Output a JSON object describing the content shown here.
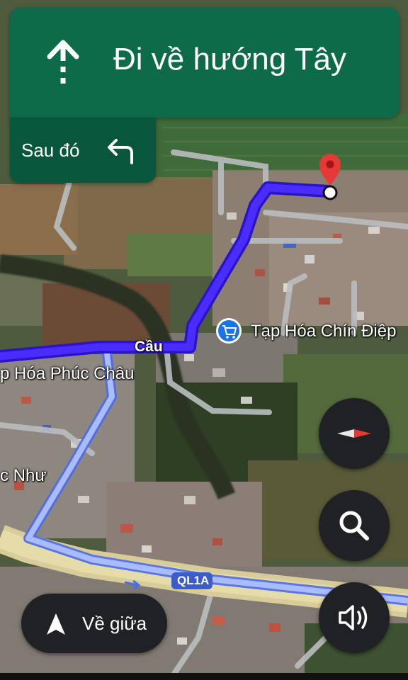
{
  "navigation": {
    "primary_instruction": "Đi về hướng Tây",
    "next_label": "Sau đó"
  },
  "map": {
    "labels": {
      "bridge": "Cầu",
      "store_1": "Tạp Hóa Chín Điệp",
      "store_2": "p Hóa Phúc Châu",
      "place": "c Như",
      "road": "QL1A"
    }
  },
  "controls": {
    "recenter_label": "Về giữa"
  },
  "icons": {
    "direction": "arrow-up-icon",
    "next_turn": "turn-left-icon",
    "destination": "map-pin-icon",
    "store": "shopping-cart-icon",
    "compass": "compass-icon",
    "search": "search-icon",
    "sound": "speaker-icon",
    "recenter": "navigation-arrow-icon"
  },
  "colors": {
    "banner": "#0d6b4a",
    "banner_next": "#08573c",
    "route": "#3a1df0",
    "alt_route": "#9fb3ff",
    "pin": "#e53935",
    "store_marker": "#1a73e8"
  }
}
